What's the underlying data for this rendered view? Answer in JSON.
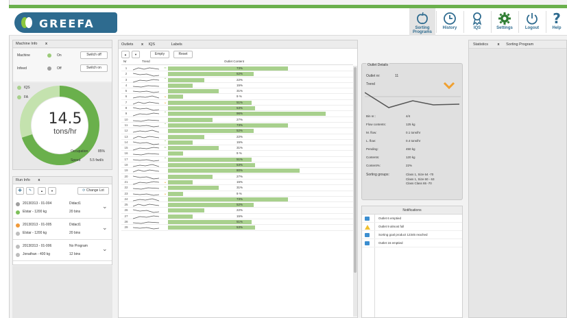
{
  "brand": {
    "name": "GREEFA"
  },
  "nav": [
    {
      "label": "Sorting\nPrograms",
      "icon": "sorting-programs-icon",
      "active": true
    },
    {
      "label": "History",
      "icon": "history-icon",
      "active": false
    },
    {
      "label": "IQS",
      "icon": "iqs-icon",
      "active": false
    },
    {
      "label": "Settings",
      "icon": "settings-icon",
      "active": false
    },
    {
      "label": "Logout",
      "icon": "logout-icon",
      "active": false
    },
    {
      "label": "Help",
      "icon": "help-icon",
      "active": false
    }
  ],
  "machine_info": {
    "title": "Machine Info",
    "close": "x",
    "machine_label": "Machine",
    "machine_state": "On",
    "machine_button": "Switch off",
    "infeed_label": "Infeed",
    "infeed_state": "Off",
    "infeed_button": "Switch on",
    "legend1": "IQS",
    "legend2": "FA",
    "value": "14.5",
    "unit": "tons/hr",
    "gauge_fraction": 0.7,
    "occupation_label": "Occupation",
    "occupation_value": "85%",
    "speed_label": "Speed",
    "speed_value": "5.5 fwd/s"
  },
  "run_info": {
    "title": "Run Info",
    "close": "x",
    "change_lot_label": "Change Lot",
    "runs": [
      {
        "date": "20130313 - 01-004",
        "name": "Elstar - 1200 kg",
        "grower": "Didact1",
        "bins": "20 bins",
        "color": "#7dbf5a"
      },
      {
        "date": "20130313 - 01-005",
        "name": "Elstar - 1200 kg",
        "grower": "Didact1",
        "bins": "20 bins",
        "color": "#f09a3a"
      },
      {
        "date": "20130313 - 01-006",
        "name": "Jonathan - 400 kg",
        "grower": "No Program",
        "bins": "12 bins",
        "color": "#bdbdbd"
      }
    ]
  },
  "outlets": {
    "tabs": [
      "Outlets",
      "x",
      "IQS",
      "Labels"
    ],
    "buttons": {
      "up": "▲",
      "down": "▼",
      "empty": "Empty",
      "reset": "Reset"
    },
    "columns": {
      "nr": "Nr",
      "trend": "Trend",
      "content": "Outlet Content"
    },
    "rows": [
      {
        "nr": "1",
        "pct": 73,
        "label": "73%",
        "ind": "check"
      },
      {
        "nr": "2",
        "pct": 52,
        "label": "52%",
        "ind": ""
      },
      {
        "nr": "3",
        "pct": 22,
        "label": "22%",
        "ind": "up"
      },
      {
        "nr": "4",
        "pct": 15,
        "label": "15%",
        "ind": ""
      },
      {
        "nr": "5",
        "pct": 31,
        "label": "31%",
        "ind": ""
      },
      {
        "nr": "6",
        "pct": 9,
        "label": "9 %",
        "ind": "down"
      },
      {
        "nr": "7",
        "pct": 51,
        "label": "51%",
        "ind": "down"
      },
      {
        "nr": "8",
        "pct": 53,
        "label": "53%",
        "ind": ""
      },
      {
        "nr": "9",
        "pct": 96,
        "label": "96%",
        "ind": "up"
      },
      {
        "nr": "10",
        "pct": 27,
        "label": "27%",
        "ind": ""
      },
      {
        "nr": "11",
        "pct": 73,
        "label": "73%",
        "ind": "up"
      },
      {
        "nr": "12",
        "pct": 52,
        "label": "52%",
        "ind": ""
      },
      {
        "nr": "13",
        "pct": 22,
        "label": "22%",
        "ind": ""
      },
      {
        "nr": "14",
        "pct": 15,
        "label": "15%",
        "ind": "up"
      },
      {
        "nr": "15",
        "pct": 31,
        "label": "31%",
        "ind": "check"
      },
      {
        "nr": "16",
        "pct": 9,
        "label": "9 %",
        "ind": ""
      },
      {
        "nr": "17",
        "pct": 51,
        "label": "51%",
        "ind": "up"
      },
      {
        "nr": "18",
        "pct": 53,
        "label": "53%",
        "ind": ""
      },
      {
        "nr": "19",
        "pct": 80,
        "label": "80%",
        "ind": ""
      },
      {
        "nr": "20",
        "pct": 27,
        "label": "27%",
        "ind": ""
      },
      {
        "nr": "21",
        "pct": 15,
        "label": "15%",
        "ind": "down"
      },
      {
        "nr": "22",
        "pct": 31,
        "label": "31%",
        "ind": "check"
      },
      {
        "nr": "23",
        "pct": 9,
        "label": "9 %",
        "ind": "down"
      },
      {
        "nr": "24",
        "pct": 73,
        "label": "73%",
        "ind": ""
      },
      {
        "nr": "25",
        "pct": 52,
        "label": "52%",
        "ind": ""
      },
      {
        "nr": "26",
        "pct": 22,
        "label": "22%",
        "ind": ""
      },
      {
        "nr": "27",
        "pct": 15,
        "label": "15%",
        "ind": ""
      },
      {
        "nr": "28",
        "pct": 51,
        "label": "51%",
        "ind": ""
      },
      {
        "nr": "29",
        "pct": 53,
        "label": "53%",
        "ind": ""
      }
    ]
  },
  "outlet_details": {
    "title": "Outlet Details",
    "outlet_nr_label": "Outlet nr:",
    "outlet_nr_value": "11",
    "trend_label": "Trend",
    "fields": [
      {
        "label": "Bin nr.:",
        "value": "4/4"
      },
      {
        "label": "Flow contents:",
        "value": "125 kg"
      },
      {
        "label": "M. flow:",
        "value": "0.1 tons/hr"
      },
      {
        "label": "L. flow:",
        "value": "0.4 tons/hr"
      },
      {
        "label": "Pending:",
        "value": "450 kg"
      },
      {
        "label": "Contents:",
        "value": "120 kg"
      },
      {
        "label": "Content%:",
        "value": "22%"
      }
    ],
    "groups_label": "Sorting groups:",
    "groups": [
      "Class 1, Size 64 -70",
      "Class 1, Size 60 - 63",
      "Class Class 65 -70"
    ]
  },
  "notifications": {
    "title": "Notifications",
    "items": [
      {
        "text": "Outlet 6 emptied",
        "type": "info"
      },
      {
        "text": "Outlet 9 almost full",
        "type": "warning"
      },
      {
        "text": "Sorting goal product 12345 reached",
        "type": "info"
      },
      {
        "text": "Outlet 16 emptied",
        "type": "info"
      }
    ]
  },
  "statistics": {
    "tabs": [
      "Statistics",
      "x",
      "Sorting Program"
    ]
  },
  "colors": {
    "accent": "#6ab04c",
    "brand": "#2e6b8f",
    "bar": "#a8d08d",
    "warning": "#f0a030"
  }
}
